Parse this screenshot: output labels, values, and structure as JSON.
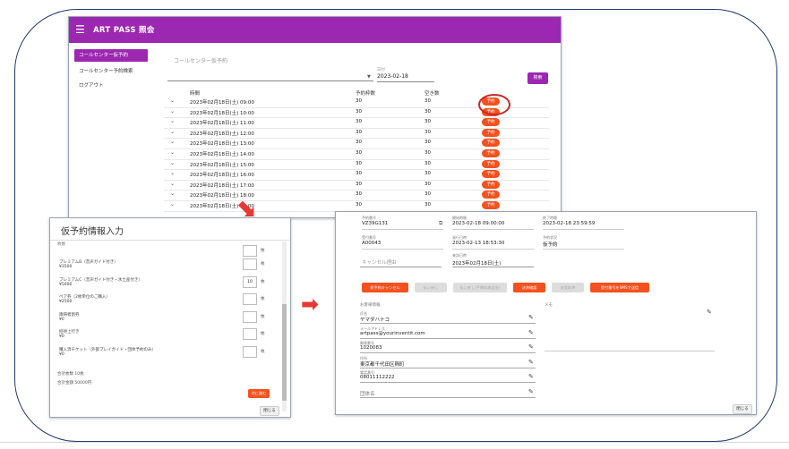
{
  "app": {
    "title": "ART PASS 照会",
    "menu_icon": "hamburger-menu-icon",
    "accent": "#9c27b0",
    "action_color": "#f4511e"
  },
  "sidebar": {
    "items": [
      {
        "label": "コールセンター仮予約",
        "active": true
      },
      {
        "label": "コールセンター予約検索",
        "active": false
      },
      {
        "label": "ログアウト",
        "active": false
      }
    ]
  },
  "main": {
    "section_title": "コールセンター仮予約",
    "date_label": "日付",
    "date_value": "2023-02-18",
    "search_label": "検索",
    "headers": {
      "time": "時間",
      "reserved": "予約枠数",
      "available": "空き数"
    },
    "rows": [
      {
        "time": "2023年02月18日(土) 09:00",
        "reserved": "30",
        "available": "30",
        "action": "予約"
      },
      {
        "time": "2023年02月18日(土) 10:00",
        "reserved": "30",
        "available": "30",
        "action": "予約"
      },
      {
        "time": "2023年02月18日(土) 11:00",
        "reserved": "30",
        "available": "30",
        "action": "予約"
      },
      {
        "time": "2023年02月18日(土) 12:00",
        "reserved": "30",
        "available": "30",
        "action": "予約"
      },
      {
        "time": "2023年02月18日(土) 13:00",
        "reserved": "30",
        "available": "30",
        "action": "予約"
      },
      {
        "time": "2023年02月18日(土) 14:00",
        "reserved": "30",
        "available": "30",
        "action": "予約"
      },
      {
        "time": "2023年02月18日(土) 15:00",
        "reserved": "30",
        "available": "30",
        "action": "予約"
      },
      {
        "time": "2023年02月18日(土) 16:00",
        "reserved": "30",
        "available": "30",
        "action": "予約"
      },
      {
        "time": "2023年02月18日(土) 17:00",
        "reserved": "30",
        "available": "30",
        "action": "予約"
      },
      {
        "time": "2023年02月18日(土) 18:00",
        "reserved": "30",
        "available": "30",
        "action": "予約"
      },
      {
        "time": "2023年02月18日(土) 19:00",
        "reserved": "30",
        "available": "30",
        "action": "予約"
      }
    ]
  },
  "dialog1": {
    "title": "仮予約情報入力",
    "count_label": "枚数",
    "items": [
      {
        "name": "プレミアムB（音声ガイド付き）",
        "price": "¥3500",
        "qty": "",
        "unit": "枚"
      },
      {
        "name": "プレミアムC（音声ガイド付き・氷土産付き）",
        "price": "¥5000",
        "qty": "10",
        "unit": "枚"
      },
      {
        "name": "ペア券（2枚単位のご購入）",
        "price": "¥2500",
        "qty": "",
        "unit": "枚"
      },
      {
        "name": "障碍者割券",
        "price": "¥0",
        "qty": "",
        "unit": "枚"
      },
      {
        "name": "招待上行き",
        "price": "¥0",
        "qty": "",
        "unit": "枚"
      },
      {
        "name": "購入済チケット（外部プレイガイド・団体予約のみ）",
        "price": "¥0",
        "qty": "",
        "unit": "枚"
      }
    ],
    "total_count": "合計枚数 10枚",
    "total_amount": "合計金額 50000円",
    "confirm_label": "次に進む",
    "close_label": "閉じる"
  },
  "dialog2": {
    "fields": [
      {
        "label": "予約番号",
        "value": "VZ39G131"
      },
      {
        "label": "開始時間",
        "value": "2023-02-18 09:00:00"
      },
      {
        "label": "終了時間",
        "value": "2023-02-18 23:59:59"
      },
      {
        "label": "受付番号",
        "value": "A00043"
      },
      {
        "label": "発行日時",
        "value": "2023-02-13 18:53:30"
      },
      {
        "label": "予約状況",
        "value": "仮予約"
      }
    ],
    "cancel_reason_placeholder": "キャンセル理由",
    "visit_date_label": "来訪日時",
    "visit_date_value": "2023年02月18日(土)",
    "buttons": {
      "cancel": "仮予約キャンセル",
      "pay1": "払い戻し",
      "pay2": "払い戻し(手数料無返金)",
      "confirm": "決済確認",
      "unpaid": "未受取済",
      "sms": "受付番号をSMSで送信"
    },
    "customer_title": "お客様情報",
    "memo_label": "メモ",
    "customer": [
      {
        "label": "氏名",
        "value": "ヤマダハナコ"
      },
      {
        "label": "メールアドレス",
        "value": "artpass@yourinventit.com"
      },
      {
        "label": "郵便番号",
        "value": "1020083"
      },
      {
        "label": "住所",
        "value": "東京都千代田区麹町"
      },
      {
        "label": "電話番号",
        "value": "08011112222"
      },
      {
        "label": "",
        "value": "団体名"
      }
    ],
    "close_label": "閉じる"
  }
}
